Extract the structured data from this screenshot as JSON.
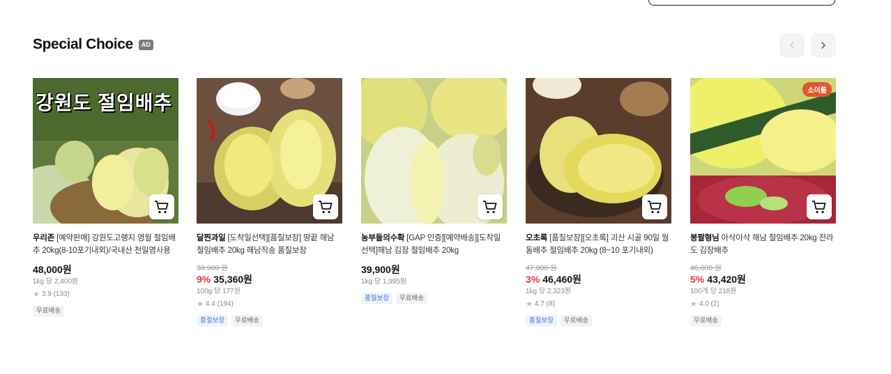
{
  "section": {
    "title": "Special Choice",
    "ad_label": "AD"
  },
  "products": [
    {
      "seller": "우리존",
      "name": "[예약판매] 강원도고랭지 영월 절임배추 20kg(8-10포기내외)/국내산 천일염사용",
      "original_price": "",
      "discount": "",
      "price": "48,000원",
      "unit_price": "1kg 당 2,400원",
      "rating": "3.9",
      "reviews": "(133)",
      "badges": [
        {
          "label": "무료배송",
          "style": "gray"
        }
      ],
      "image_text": "강원도 절임배추",
      "image": "kimchi-cabbage-photo"
    },
    {
      "seller": "달찐과일",
      "name": "[도착일선택][품질보장] 땅끝 해남 절임배추 20kg 해남직송 품질보장",
      "original_price": "38,900 원",
      "discount": "9%",
      "price": "35,360원",
      "unit_price": "100g 당 177원",
      "rating": "4.4",
      "reviews": "(194)",
      "badges": [
        {
          "label": "품질보장",
          "style": "blue"
        },
        {
          "label": "무료배송",
          "style": "gray"
        }
      ],
      "image_text": "",
      "image": "salted-cabbage-photo"
    },
    {
      "seller": "농부들의수확",
      "name": "[GAP 인증][예약배송][도착일선택]해남 김장 절임배추 20kg",
      "original_price": "",
      "discount": "",
      "price": "39,900원",
      "unit_price": "1kg 당 1,995원",
      "rating": "",
      "reviews": "",
      "badges": [
        {
          "label": "품질보장",
          "style": "blue"
        },
        {
          "label": "무료배송",
          "style": "gray"
        }
      ],
      "image_text": "",
      "image": "salted-cabbage-photo"
    },
    {
      "seller": "오초록",
      "name": "[품질보장][오초록] 괴산 시골 90일 월동배추 절임배추 20kg (8~10 포기내외)",
      "original_price": "47,900 원",
      "discount": "3%",
      "price": "46,460원",
      "unit_price": "1kg 당 2,323원",
      "rating": "4.7",
      "reviews": "(8)",
      "badges": [
        {
          "label": "품질보장",
          "style": "blue"
        },
        {
          "label": "무료배송",
          "style": "gray"
        }
      ],
      "image_text": "",
      "image": "salted-cabbage-photo"
    },
    {
      "seller": "봉팔형님",
      "name": "아삭아삭 해남 절임배추 20kg 전라도 김장배추",
      "original_price": "46,000 원",
      "discount": "5%",
      "price": "43,420원",
      "unit_price": "100개 당 218원",
      "rating": "4.0",
      "reviews": "(2)",
      "badges": [
        {
          "label": "무료배송",
          "style": "gray"
        }
      ],
      "image_text": "소이룸",
      "image": "cabbage-kimchi-filling-photo"
    }
  ],
  "icons": {
    "cart": "cart-icon",
    "prev": "chevron-left-icon",
    "next": "chevron-right-icon",
    "star": "star-icon",
    "search": "search-icon"
  },
  "colors": {
    "discount": "#e5383b",
    "quality_badge": "#3b6fd8",
    "ad_badge": "#7a7a7a"
  }
}
